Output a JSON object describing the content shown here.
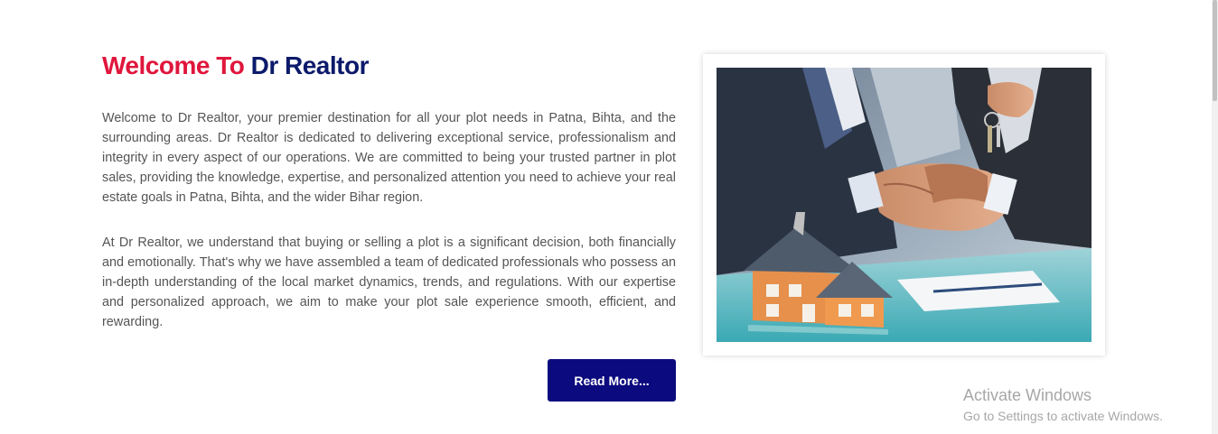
{
  "welcome": {
    "title_part1": "Welcome To ",
    "title_part2": "Dr Realtor"
  },
  "about": {
    "paragraph1": "Welcome to Dr Realtor, your premier destination for all your plot needs in Patna, Bihta, and the surrounding areas. Dr Realtor is dedicated to delivering exceptional service, professionalism and integrity in every aspect of our operations. We are committed to being your trusted partner in plot sales, providing the knowledge, expertise, and personalized attention you need to achieve your real estate goals in Patna, Bihta, and the wider Bihar region.",
    "paragraph2": "At Dr Realtor, we understand that buying or selling a plot is a significant decision, both financially and emotionally. That's why we have assembled a team of dedicated professionals who possess an in-depth understanding of the local market dynamics, trends, and regulations. With our expertise and personalized approach, we aim to make your plot sale experience smooth, efficient, and rewarding.",
    "read_more_label": "Read More..."
  },
  "image": {
    "subject": "handshake-with-house-model-and-keys"
  },
  "watermark": {
    "title": "Activate Windows",
    "subtitle": "Go to Settings to activate Windows."
  },
  "colors": {
    "title_red": "#e0163c",
    "title_navy": "#0c1a6b",
    "button_bg": "#0b0a7e",
    "body_text": "#555555"
  }
}
